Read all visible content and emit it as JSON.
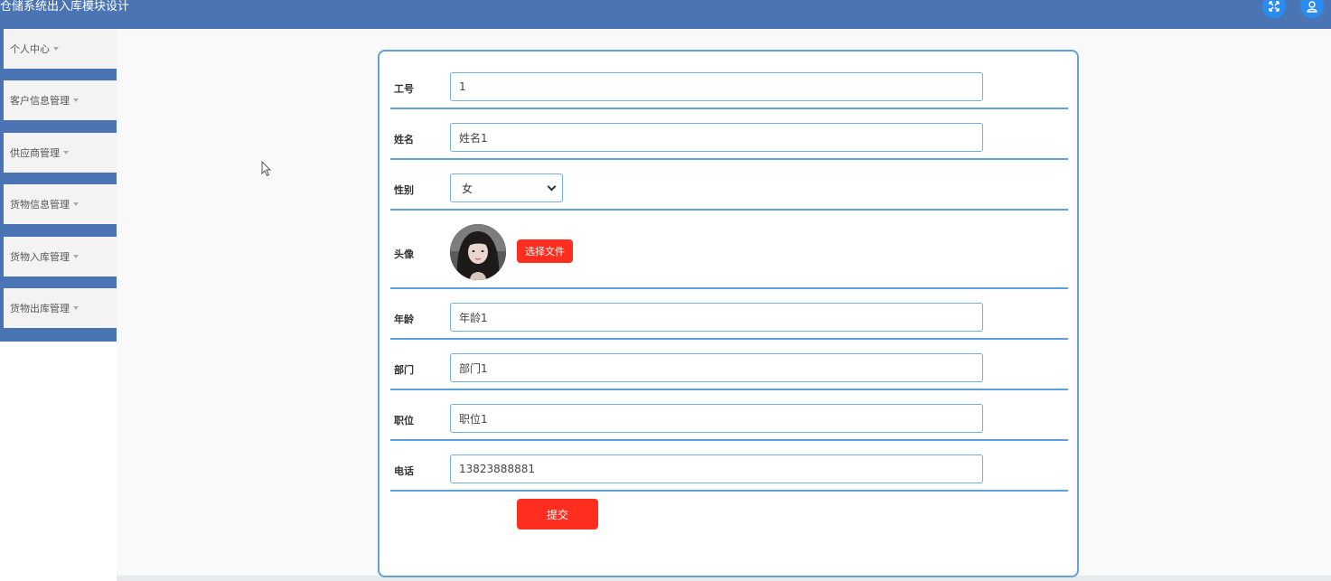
{
  "app": {
    "title": "仓储系统出入库模块设计"
  },
  "header": {
    "fullscreen_icon": "fullscreen-icon",
    "user_icon": "user-icon"
  },
  "sidebar": {
    "items": [
      {
        "label": "个人中心"
      },
      {
        "label": "客户信息管理"
      },
      {
        "label": "供应商管理"
      },
      {
        "label": "货物信息管理"
      },
      {
        "label": "货物入库管理"
      },
      {
        "label": "货物出库管理"
      }
    ]
  },
  "form": {
    "fields": {
      "employee_id": {
        "label": "工号",
        "value": "1"
      },
      "name": {
        "label": "姓名",
        "value": "姓名1"
      },
      "gender": {
        "label": "性别",
        "value": "女"
      },
      "avatar": {
        "label": "头像",
        "button": "选择文件"
      },
      "age": {
        "label": "年龄",
        "value": "年龄1"
      },
      "department": {
        "label": "部门",
        "value": "部门1"
      },
      "position": {
        "label": "职位",
        "value": "职位1"
      },
      "phone": {
        "label": "电话",
        "value": "13823888881"
      }
    },
    "submit_label": "提交"
  },
  "colors": {
    "header_bg": "#4a74b4",
    "accent_border": "#5fa2dd",
    "primary_button": "#ff2e1f",
    "icon_circle": "#2a8cf0"
  }
}
